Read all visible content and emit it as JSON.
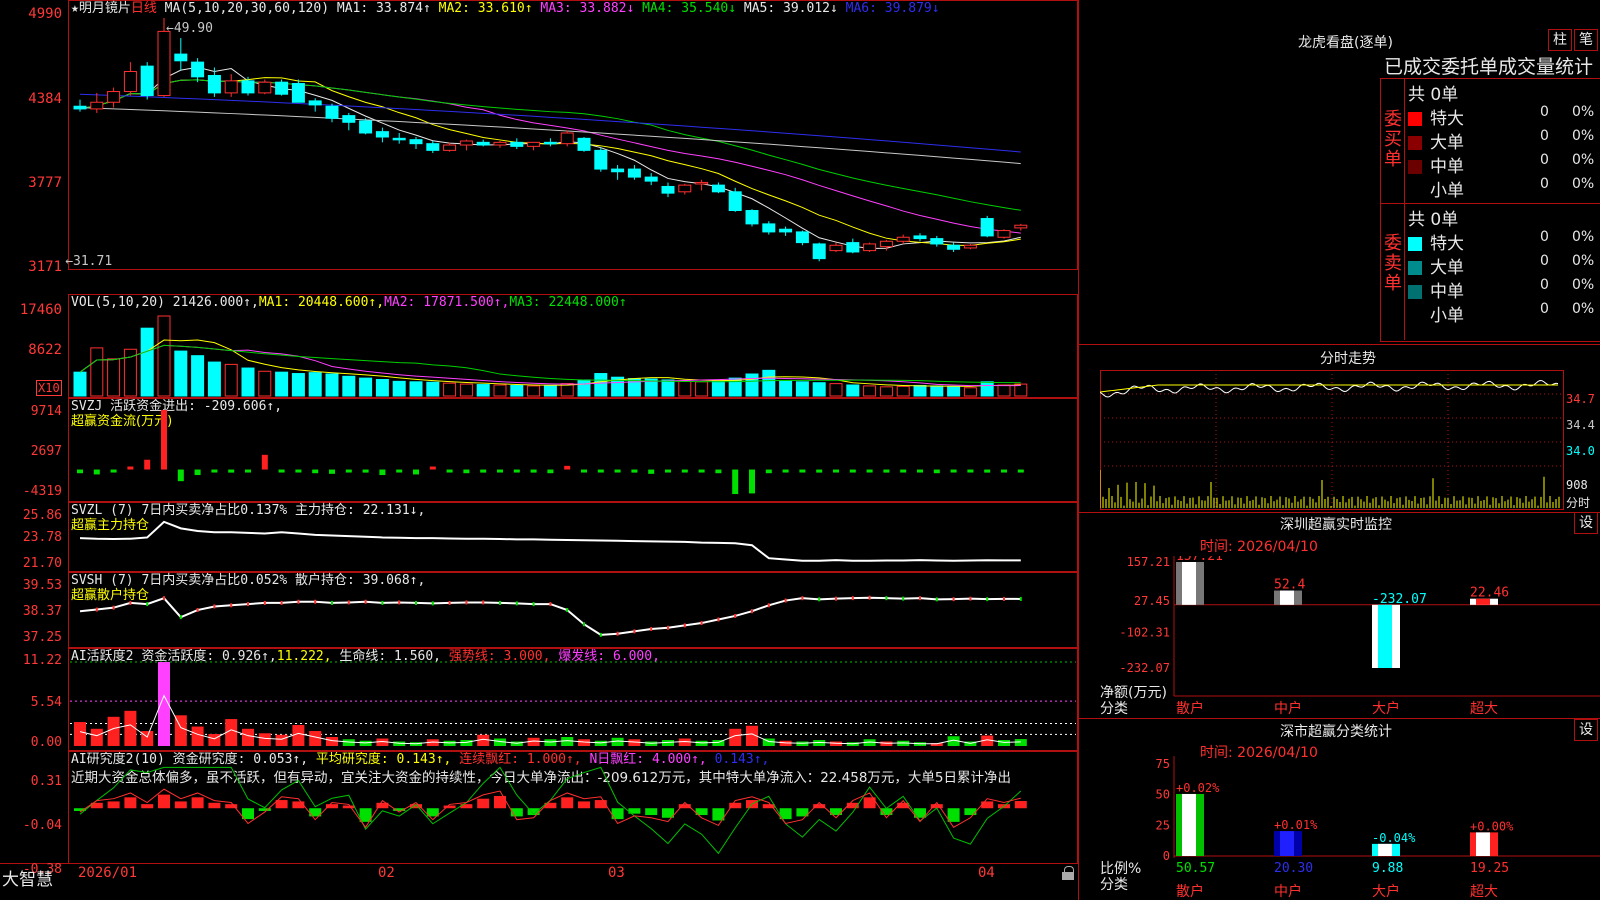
{
  "app_name": "大智慧",
  "main": {
    "title": "★明月镜片",
    "period": "日线",
    "ma_params": "MA(5,10,20,30,60,120)",
    "ma1": "MA1: 33.874↑",
    "ma2": "MA2: 33.610↑",
    "ma3": "MA3: 33.882↓",
    "ma4": "MA4: 35.540↓",
    "ma5": "MA5: 39.012↓",
    "ma6": "MA6: 39.879↓",
    "high_marker": "49.90",
    "low_marker": "31.71",
    "y_ticks": [
      "4990",
      "4384",
      "3777",
      "3171"
    ]
  },
  "vol": {
    "title": "VOL(5,10,20) 21426.000↑,",
    "ma1": "MA1: 20448.600↑,",
    "ma2": "MA2: 17871.500↑,",
    "ma3": "MA3: 22448.000↑",
    "y_ticks": [
      "17460",
      "8622"
    ],
    "unit": "X10"
  },
  "svzj": {
    "title": "SVZJ  活跃资金进出: -209.606↑,",
    "subtitle": "超赢资金流(万元)",
    "y_ticks": [
      "9714",
      "2697",
      "-4319"
    ]
  },
  "svzl": {
    "title": "SVZL (7) 7日内买卖净占比0.137% 主力持仓: 22.131↓,",
    "subtitle": "超赢主力持仓",
    "y_ticks": [
      "25.86",
      "23.78",
      "21.70"
    ]
  },
  "svsh": {
    "title": "SVSH (7) 7日内买卖净占比0.052% 散户持仓: 39.068↑,",
    "subtitle": "超赢散户持仓",
    "y_ticks": [
      "39.53",
      "38.37",
      "37.25"
    ]
  },
  "ai_active": {
    "name": "AI活跃度2",
    "label1": "资金活跃度: 0.926↑,",
    "label2": "11.222,",
    "label3": "生命线: 1.560,",
    "label4": "强势线: 3.000,",
    "label5": "爆发线: 6.000,",
    "y_ticks": [
      "11.22",
      "5.54",
      "0.00"
    ]
  },
  "ai_research": {
    "name": "AI研究度2(10)",
    "label1": "资金研究度: 0.053↑,",
    "label2": "平均研究度: 0.143↑,",
    "label3": "连续飘红: 1.000↑,",
    "label4": "N日飘红: 4.000↑,",
    "label5": "0.143↑,",
    "comment": "近期大资金总体偏多，虽不活跃，但有异动，宜关注大资金的持续性，今日大单净流出：-209.612万元，其中特大单净流入：22.458万元，大单5日累计净出",
    "y_ticks": [
      "0.31",
      "-0.04",
      "-0.38"
    ]
  },
  "x_axis": [
    "2026/01",
    "02",
    "03",
    "04"
  ],
  "right": {
    "lhb_title": "龙虎看盘(逐单)",
    "btn_zhu": "柱",
    "btn_bi": "笔",
    "stat_title": "已成交委托单成交量统计",
    "buy_side": "委买单",
    "sell_side": "委卖单",
    "buy_total": "共 0单",
    "sell_total": "共 0单",
    "buy_rows": [
      {
        "label": "特大",
        "count": "0",
        "pct": "0%",
        "color": "#ff0000"
      },
      {
        "label": "大单",
        "count": "0",
        "pct": "0%",
        "color": "#8a0000"
      },
      {
        "label": "中单",
        "count": "0",
        "pct": "0%",
        "color": "#6a0000"
      },
      {
        "label": "小单",
        "count": "0",
        "pct": "0%",
        "color": ""
      }
    ],
    "sell_rows": [
      {
        "label": "特大",
        "count": "0",
        "pct": "0%",
        "color": "#00ffff"
      },
      {
        "label": "大单",
        "count": "0",
        "pct": "0%",
        "color": "#008c8c"
      },
      {
        "label": "中单",
        "count": "0",
        "pct": "0%",
        "color": "#007070"
      },
      {
        "label": "小单",
        "count": "0",
        "pct": "0%",
        "color": ""
      }
    ],
    "intraday_title": "分时走势",
    "intraday_prices": [
      "34.7",
      "34.4",
      "34.0"
    ],
    "intraday_vol": "908",
    "intraday_vol_unit": "分时",
    "monitor_title": "深圳超赢实时监控",
    "monitor_settings": "设",
    "monitor_time": "时间: 2026/04/10",
    "monitor_y": [
      "157.21",
      "27.45",
      "-102.31",
      "-232.07"
    ],
    "monitor_ylabel": "净额(万元)",
    "monitor_xlabel": "分类",
    "class_title": "深市超赢分类统计",
    "class_settings": "设",
    "class_time": "时间: 2026/04/10",
    "class_y": [
      "75",
      "50",
      "25",
      "0"
    ],
    "class_ylabel": "比例%",
    "class_xlabel": "分类"
  },
  "chart_data": [
    {
      "type": "candlestick",
      "title": "明月镜片 日线",
      "ylim": [
        31.2,
        50.5
      ],
      "x_labels": [
        "2026/01",
        "02",
        "03",
        "04"
      ],
      "ohlc": [
        [
          43.3,
          43.8,
          42.9,
          43.1
        ],
        [
          43.1,
          44.3,
          42.8,
          43.6
        ],
        [
          43.6,
          44.7,
          43.2,
          44.4
        ],
        [
          44.4,
          46.6,
          44.1,
          45.9
        ],
        [
          46.3,
          46.6,
          43.8,
          44.1
        ],
        [
          44.1,
          49.9,
          44.0,
          48.9
        ],
        [
          47.2,
          48.4,
          46.0,
          46.7
        ],
        [
          46.6,
          46.9,
          45.1,
          45.5
        ],
        [
          45.6,
          46.2,
          44.0,
          44.3
        ],
        [
          44.3,
          45.7,
          44.0,
          45.2
        ],
        [
          45.2,
          45.5,
          44.1,
          44.3
        ],
        [
          44.3,
          45.3,
          44.2,
          45.1
        ],
        [
          45.1,
          45.3,
          44.1,
          44.2
        ],
        [
          45.0,
          45.3,
          43.6,
          43.6
        ],
        [
          43.7,
          43.9,
          42.9,
          43.4
        ],
        [
          43.3,
          43.5,
          42.1,
          42.4
        ],
        [
          42.6,
          42.8,
          41.5,
          42.1
        ],
        [
          42.2,
          42.4,
          41.2,
          41.3
        ],
        [
          41.4,
          41.7,
          40.6,
          41.0
        ],
        [
          40.9,
          41.3,
          40.5,
          40.8
        ],
        [
          40.8,
          41.0,
          40.1,
          40.5
        ],
        [
          40.5,
          40.7,
          39.8,
          40.0
        ],
        [
          40.0,
          40.6,
          39.9,
          40.4
        ],
        [
          40.4,
          40.8,
          40.0,
          40.7
        ],
        [
          40.6,
          40.8,
          40.3,
          40.4
        ],
        [
          40.4,
          40.7,
          40.2,
          40.6
        ],
        [
          40.6,
          40.9,
          40.1,
          40.3
        ],
        [
          40.3,
          40.6,
          40.0,
          40.6
        ],
        [
          40.6,
          40.9,
          40.3,
          40.5
        ],
        [
          40.5,
          41.5,
          40.3,
          41.3
        ],
        [
          40.9,
          41.0,
          39.9,
          40.0
        ],
        [
          40.0,
          40.2,
          38.4,
          38.6
        ],
        [
          38.6,
          38.9,
          37.8,
          38.4
        ],
        [
          38.6,
          38.9,
          37.8,
          38.0
        ],
        [
          38.0,
          38.3,
          37.4,
          37.7
        ],
        [
          37.3,
          37.6,
          36.5,
          36.8
        ],
        [
          36.9,
          37.5,
          36.7,
          37.4
        ],
        [
          37.5,
          37.8,
          37.0,
          37.6
        ],
        [
          37.4,
          37.6,
          36.8,
          36.9
        ],
        [
          36.9,
          37.2,
          35.4,
          35.5
        ],
        [
          35.5,
          35.6,
          34.3,
          34.5
        ],
        [
          34.5,
          34.7,
          33.7,
          33.9
        ],
        [
          34.1,
          34.3,
          33.6,
          33.9
        ],
        [
          33.9,
          34.0,
          32.9,
          33.1
        ],
        [
          33.0,
          33.1,
          31.7,
          31.9
        ],
        [
          32.5,
          33.1,
          32.4,
          32.9
        ],
        [
          33.1,
          33.4,
          32.3,
          32.4
        ],
        [
          32.5,
          33.1,
          32.4,
          33.0
        ],
        [
          32.8,
          33.3,
          32.5,
          33.2
        ],
        [
          33.2,
          33.7,
          33.0,
          33.5
        ],
        [
          33.6,
          33.8,
          33.2,
          33.4
        ],
        [
          33.4,
          33.6,
          32.8,
          33.0
        ],
        [
          32.9,
          33.1,
          32.4,
          32.6
        ],
        [
          32.7,
          33.0,
          32.6,
          32.9
        ],
        [
          34.9,
          35.1,
          33.5,
          33.6
        ],
        [
          33.5,
          34.1,
          33.4,
          34.0
        ],
        [
          34.2,
          34.5,
          34.0,
          34.4
        ]
      ],
      "ma_ends": {
        "MA1": 33.874,
        "MA2": 33.61,
        "MA3": 33.882,
        "MA4": 35.54,
        "MA5": 39.012,
        "MA6": 39.879
      },
      "high": 49.9,
      "low": 31.71
    },
    {
      "type": "bar",
      "title": "VOL(5,10,20)",
      "ylim": [
        0,
        17460
      ],
      "values": [
        5200,
        10500,
        8100,
        10200,
        14800,
        17460,
        9800,
        8800,
        7400,
        6900,
        6100,
        5400,
        5200,
        4900,
        5100,
        4800,
        4300,
        3900,
        3600,
        3200,
        3100,
        3000,
        2800,
        2600,
        2500,
        2400,
        2300,
        2200,
        2300,
        2700,
        3500,
        4900,
        4100,
        3800,
        3700,
        3500,
        3200,
        3100,
        3300,
        3900,
        4800,
        5600,
        3400,
        3100,
        2900,
        2700,
        2400,
        2200,
        2000,
        2100,
        2300,
        2200,
        2100,
        1800,
        3100,
        2400,
        2600
      ],
      "ma_ends": {
        "MA1": 20448.6,
        "MA2": 17871.5,
        "MA3": 22448.0
      }
    },
    {
      "type": "bar",
      "title": "超赢资金流(万元)",
      "ylim": [
        -4319,
        9714
      ],
      "values": [
        -600,
        -800,
        -400,
        300,
        1600,
        9714,
        -1900,
        -900,
        -300,
        -500,
        -200,
        2400,
        -300,
        -400,
        -600,
        -700,
        -300,
        -500,
        -900,
        -200,
        -800,
        400,
        -200,
        -600,
        -500,
        -400,
        -300,
        -500,
        -600,
        600,
        -200,
        -400,
        -300,
        -500,
        -700,
        -300,
        -200,
        -400,
        -600,
        -4000,
        -3900,
        -600,
        -400,
        -300,
        -500,
        -200,
        -400,
        -300,
        -500,
        -400,
        -300,
        -600,
        -200,
        -400,
        -500,
        -300,
        -209.6
      ]
    },
    {
      "type": "line",
      "title": "超赢主力持仓",
      "ylim": [
        21.7,
        25.86
      ],
      "values": [
        23.85,
        23.8,
        23.78,
        23.8,
        23.9,
        25.1,
        24.6,
        24.4,
        24.3,
        24.3,
        24.25,
        24.2,
        24.3,
        24.2,
        24.1,
        24.05,
        24.0,
        23.95,
        23.9,
        23.88,
        23.85,
        23.85,
        23.82,
        23.8,
        23.8,
        23.78,
        23.75,
        23.75,
        23.72,
        23.7,
        23.68,
        23.66,
        23.65,
        23.62,
        23.6,
        23.58,
        23.56,
        23.5,
        23.48,
        23.45,
        23.3,
        22.3,
        22.2,
        22.1,
        22.1,
        22.15,
        22.1,
        22.1,
        22.12,
        22.12,
        22.15,
        22.12,
        22.1,
        22.12,
        22.14,
        22.13,
        22.131
      ]
    },
    {
      "type": "line",
      "title": "超赢散户持仓",
      "ylim": [
        37.25,
        39.53
      ],
      "values": [
        38.55,
        38.62,
        38.7,
        38.9,
        38.85,
        39.1,
        38.3,
        38.6,
        38.75,
        38.8,
        38.85,
        38.9,
        38.9,
        38.95,
        38.95,
        38.9,
        38.92,
        38.95,
        38.9,
        38.92,
        38.9,
        38.88,
        38.9,
        38.92,
        38.92,
        38.9,
        38.88,
        38.85,
        38.85,
        38.6,
        38.0,
        37.55,
        37.6,
        37.7,
        37.8,
        37.85,
        37.95,
        38.05,
        38.2,
        38.35,
        38.55,
        38.8,
        39.0,
        39.1,
        39.05,
        39.08,
        39.1,
        39.12,
        39.1,
        39.08,
        39.1,
        39.05,
        39.06,
        39.08,
        39.06,
        39.07,
        39.068
      ]
    },
    {
      "type": "bar",
      "title": "AI活跃度2",
      "ylim": [
        0,
        11.22
      ],
      "values": [
        3.2,
        2.3,
        3.9,
        4.7,
        2.0,
        11.222,
        4.1,
        2.6,
        1.6,
        3.6,
        2.3,
        1.7,
        1.5,
        2.8,
        2.0,
        1.2,
        0.9,
        0.7,
        1.0,
        0.6,
        0.5,
        0.9,
        0.7,
        0.8,
        1.5,
        1.0,
        0.6,
        1.1,
        0.9,
        1.2,
        0.9,
        0.7,
        1.1,
        0.9,
        0.6,
        0.8,
        1.0,
        0.7,
        0.8,
        2.3,
        2.7,
        1.0,
        0.7,
        0.6,
        0.8,
        0.6,
        0.5,
        0.9,
        0.6,
        0.7,
        0.5,
        0.4,
        1.3,
        0.6,
        1.4,
        0.8,
        0.926
      ],
      "lines": {
        "生命线": 1.56,
        "强势线": 3.0,
        "爆发线": 6.0
      }
    },
    {
      "type": "bar",
      "title": "AI研究度2(10)",
      "ylim": [
        -0.38,
        0.31
      ],
      "values": [
        -0.02,
        0.04,
        0.05,
        0.08,
        0.03,
        0.1,
        0.05,
        0.08,
        0.04,
        0.03,
        -0.08,
        -0.02,
        0.06,
        0.05,
        -0.06,
        0.03,
        0.02,
        -0.1,
        0.04,
        -0.02,
        0.03,
        -0.06,
        0.02,
        0.03,
        0.07,
        0.09,
        -0.06,
        -0.05,
        0.04,
        0.08,
        0.05,
        0.06,
        -0.08,
        -0.04,
        -0.05,
        -0.07,
        0.03,
        -0.05,
        -0.09,
        0.04,
        0.06,
        0.03,
        -0.08,
        -0.06,
        0.03,
        -0.05,
        0.04,
        0.08,
        -0.05,
        0.04,
        -0.07,
        0.03,
        -0.1,
        -0.05,
        0.05,
        0.03,
        0.053
      ]
    },
    {
      "type": "bar",
      "title": "深圳超赢实时监控",
      "categories": [
        "散户",
        "中户",
        "大户",
        "超大"
      ],
      "values": [
        157.21,
        52.4,
        -232.07,
        22.46
      ],
      "ylim": [
        -232.07,
        157.21
      ]
    },
    {
      "type": "bar",
      "title": "深市超赢分类统计",
      "categories": [
        "散户",
        "中户",
        "大户",
        "超大"
      ],
      "values": [
        50.57,
        20.3,
        9.88,
        19.25
      ],
      "changes": [
        "+0.02%",
        "+0.01%",
        "-0.04%",
        "+0.00%"
      ],
      "ylim": [
        0,
        75
      ]
    }
  ]
}
